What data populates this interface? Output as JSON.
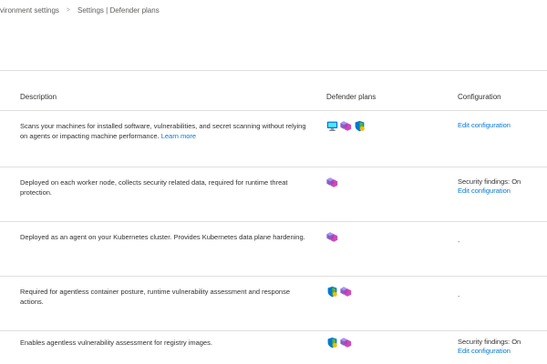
{
  "breadcrumb": {
    "items": [
      "vironment settings",
      "Settings | Defender plans"
    ],
    "separator": ">"
  },
  "table": {
    "columns": {
      "description": "Description",
      "plans": "Defender plans",
      "configuration": "Configuration"
    },
    "rows": [
      {
        "description": "Scans your machines for installed software, vulnerabilities, and secret scanning without relying on agents or impacting machine performance.",
        "learn_more": "Learn more",
        "plan_icons": [
          "servers-plan-icon",
          "containers-plan-icon",
          "cspm-plan-icon"
        ],
        "config_status": "",
        "config_link": "Edit configuration",
        "config_dash": ""
      },
      {
        "description": "Deployed on each worker node, collects security related data, required for runtime threat protection.",
        "learn_more": "",
        "plan_icons": [
          "containers-plan-icon"
        ],
        "config_status": "Security findings: On",
        "config_link": "Edit configuration",
        "config_dash": ""
      },
      {
        "description": "Deployed as an agent on your Kubernetes cluster. Provides Kubernetes data plane hardening.",
        "learn_more": "",
        "plan_icons": [
          "containers-plan-icon"
        ],
        "config_status": "",
        "config_link": "",
        "config_dash": "-"
      },
      {
        "description": "Required for agentless container posture, runtime vulnerability assessment and response actions.",
        "learn_more": "",
        "plan_icons": [
          "cspm-plan-icon",
          "containers-plan-icon"
        ],
        "config_status": "",
        "config_link": "",
        "config_dash": "-"
      },
      {
        "description": "Enables agentless vulnerability assessment for registry images.",
        "learn_more": "",
        "plan_icons": [
          "cspm-plan-icon",
          "containers-plan-icon"
        ],
        "config_status": "Security findings: On",
        "config_link": "Edit configuration",
        "config_dash": ""
      }
    ]
  },
  "colors": {
    "link": "#0078d4",
    "text": "#323130",
    "muted": "#605e5c",
    "divider": "#e1dfdd",
    "icon_blue": "#0078d4",
    "icon_purple": "#8661c5",
    "icon_magenta": "#c239b3",
    "icon_green": "#5bb529",
    "icon_yellow": "#ffb900"
  }
}
